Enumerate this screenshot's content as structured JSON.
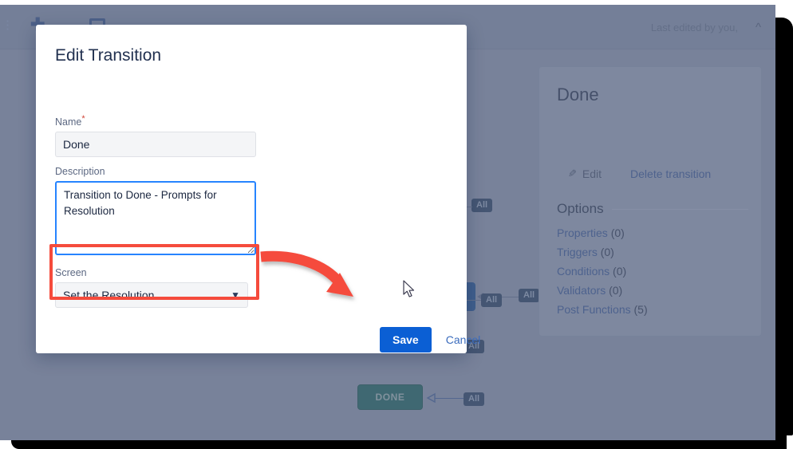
{
  "toolbar": {
    "dots_icon": "more-options-icon",
    "plus_icon": "add-icon",
    "box_icon": "layout-icon",
    "last_edited": "Last edited by you,",
    "collapse_icon": "chevron-up-double-icon"
  },
  "modal": {
    "title": "Edit Transition",
    "name_label": "Name",
    "name_required_mark": "*",
    "name_value": "Done",
    "name_placeholder": "Name",
    "description_label": "Description",
    "description_value": "Transition to Done - Prompts for Resolution",
    "description_placeholder": "Description",
    "screen_label": "Screen",
    "screen_value": "Set the Resolution",
    "screen_options": [
      "Set the Resolution"
    ],
    "save_label": "Save",
    "cancel_label": "Cancel"
  },
  "annotation": {
    "highlight_color": "#f54b3c",
    "arrow_color": "#f54b3c",
    "target": "screen-select"
  },
  "side_panel": {
    "title": "Done",
    "edit_label": "Edit",
    "edit_icon": "pencil-icon",
    "delete_label": "Delete transition",
    "options_header": "Options",
    "links": [
      {
        "label": "Properties",
        "count": "(0)"
      },
      {
        "label": "Triggers",
        "count": "(0)"
      },
      {
        "label": "Conditions",
        "count": "(0)"
      },
      {
        "label": "Validators",
        "count": "(0)"
      },
      {
        "label": "Post Functions",
        "count": "(5)"
      }
    ]
  },
  "workflow": {
    "chips": [
      "All",
      "All",
      "All",
      "All",
      "All"
    ],
    "nodes": [
      {
        "label": "",
        "color": "#11478f"
      },
      {
        "label": "",
        "color": "#11478f"
      },
      {
        "label": "DONE",
        "color": "#0f5c52"
      }
    ],
    "done_label": "DONE"
  },
  "colors": {
    "overlay": "#8c96ab",
    "toolbar": "#848fa6",
    "primary_blue": "#0b5fd4",
    "link_blue": "#2e4f90",
    "node_blue": "#11478f",
    "node_green": "#0f5c52",
    "focus_blue": "#2684ff",
    "annotation_red": "#f54b3c"
  }
}
